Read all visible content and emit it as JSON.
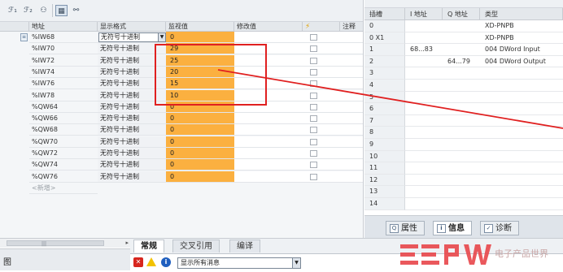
{
  "toolbar": {
    "icons": [
      "modify-values-icon",
      "modify-now-icon",
      "monitor-all-icon",
      "show-hide-columns-icon",
      "glasses-icon"
    ]
  },
  "watch_table": {
    "columns": {
      "address": "地址",
      "display_format": "显示格式",
      "monitor_value": "监视值",
      "modify_value": "修改值",
      "modify_flag_icon": "lightning-icon",
      "comment": "注释"
    },
    "rows": [
      {
        "address": "%IW68",
        "format": "无符号十进制",
        "value": "0",
        "selected": true
      },
      {
        "address": "%IW70",
        "format": "无符号十进制",
        "value": "29"
      },
      {
        "address": "%IW72",
        "format": "无符号十进制",
        "value": "25"
      },
      {
        "address": "%IW74",
        "format": "无符号十进制",
        "value": "20"
      },
      {
        "address": "%IW76",
        "format": "无符号十进制",
        "value": "15"
      },
      {
        "address": "%IW78",
        "format": "无符号十进制",
        "value": "10"
      },
      {
        "address": "%QW64",
        "format": "无符号十进制",
        "value": "0"
      },
      {
        "address": "%QW66",
        "format": "无符号十进制",
        "value": "0"
      },
      {
        "address": "%QW68",
        "format": "无符号十进制",
        "value": "0"
      },
      {
        "address": "%QW70",
        "format": "无符号十进制",
        "value": "0"
      },
      {
        "address": "%QW72",
        "format": "无符号十进制",
        "value": "0"
      },
      {
        "address": "%QW74",
        "format": "无符号十进制",
        "value": "0"
      },
      {
        "address": "%QW76",
        "format": "无符号十进制",
        "value": "0"
      }
    ],
    "add_new_placeholder": "<新增>"
  },
  "device_table": {
    "columns": {
      "slot": "插槽",
      "i_address": "I 地址",
      "q_address": "Q 地址",
      "type": "类型"
    },
    "rows": [
      {
        "slot": "0",
        "i": "",
        "q": "",
        "type": "XD-PNPB"
      },
      {
        "slot": "0 X1",
        "i": "",
        "q": "",
        "type": "XD-PNPB"
      },
      {
        "slot": "1",
        "i": "68...83",
        "q": "",
        "type": "004 DWord Input"
      },
      {
        "slot": "2",
        "i": "",
        "q": "64...79",
        "type": "004 DWord Output"
      },
      {
        "slot": "3",
        "i": "",
        "q": "",
        "type": ""
      },
      {
        "slot": "4",
        "i": "",
        "q": "",
        "type": ""
      },
      {
        "slot": "5",
        "i": "",
        "q": "",
        "type": ""
      },
      {
        "slot": "6",
        "i": "",
        "q": "",
        "type": ""
      },
      {
        "slot": "7",
        "i": "",
        "q": "",
        "type": ""
      },
      {
        "slot": "8",
        "i": "",
        "q": "",
        "type": ""
      },
      {
        "slot": "9",
        "i": "",
        "q": "",
        "type": ""
      },
      {
        "slot": "10",
        "i": "",
        "q": "",
        "type": ""
      },
      {
        "slot": "11",
        "i": "",
        "q": "",
        "type": ""
      },
      {
        "slot": "12",
        "i": "",
        "q": "",
        "type": ""
      },
      {
        "slot": "13",
        "i": "",
        "q": "",
        "type": ""
      },
      {
        "slot": "14",
        "i": "",
        "q": "",
        "type": ""
      }
    ]
  },
  "inspector_tabs": [
    {
      "label": "属性",
      "icon": "properties-icon"
    },
    {
      "label": "信息",
      "icon": "info-icon",
      "active": true
    },
    {
      "label": "诊断",
      "icon": "diagnostics-icon"
    }
  ],
  "info_panel": {
    "tabs": [
      "常规",
      "交叉引用",
      "编译"
    ],
    "filter_label": "显示所有消息"
  },
  "bottom_left_label": "图",
  "watermark": {
    "brand": "EEPW",
    "slogan": "电子产品世界"
  },
  "colors": {
    "monitor_bg": "#fbb040",
    "highlight": "#e02020",
    "header_bg": "#e4e8ec"
  }
}
